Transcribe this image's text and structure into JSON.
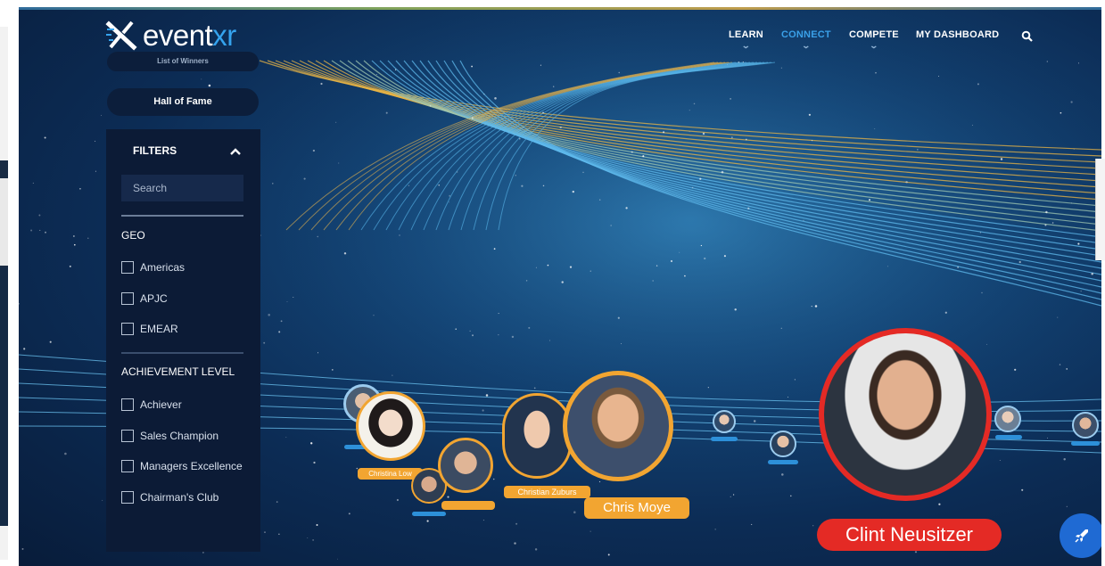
{
  "brand": {
    "name_prefix": "event",
    "name_suffix": "xr"
  },
  "nav": {
    "items": [
      {
        "label": "LEARN",
        "active": false
      },
      {
        "label": "CONNECT",
        "active": true
      },
      {
        "label": "COMPETE",
        "active": false
      },
      {
        "label": "MY DASHBOARD",
        "active": false
      }
    ],
    "search_icon": "search-icon"
  },
  "sidebar": {
    "list_button": "List of Winners",
    "hall_button": "Hall of Fame",
    "filters_title": "FILTERS",
    "search_placeholder": "Search",
    "geo": {
      "title": "GEO",
      "options": [
        "Americas",
        "APJC",
        "EMEAR"
      ]
    },
    "achievement": {
      "title": "ACHIEVEMENT LEVEL",
      "options": [
        "Achiever",
        "Sales Champion",
        "Managers Excellence",
        "Chairman's Club"
      ]
    }
  },
  "people": {
    "christina": "Christina Low",
    "christian": "Christian Zuburs",
    "chris": "Chris Moye",
    "clint": "Clint Neusitzer"
  },
  "colors": {
    "accent": "#3aa0e8",
    "tag_orange": "#f2a531",
    "highlight_red": "#e42a25",
    "panel": "#0c1b36",
    "launch_button": "#1f6ad3"
  },
  "icons": {
    "launch": "rocket-icon",
    "collapse": "chevron-up-icon"
  }
}
